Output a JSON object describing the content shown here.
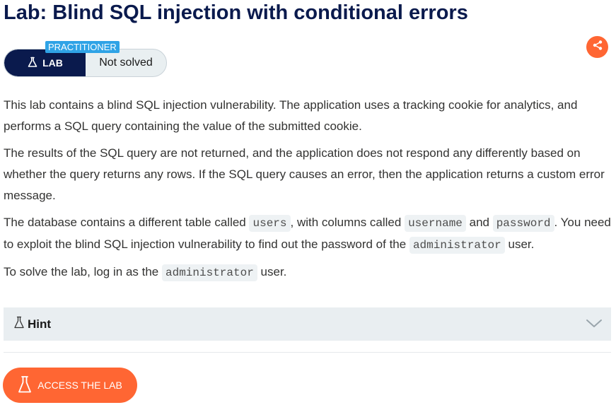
{
  "page": {
    "title": "Lab: Blind SQL injection with conditional errors"
  },
  "badge": {
    "level": "PRACTITIONER",
    "lab_label": "LAB",
    "status": "Not solved"
  },
  "description": {
    "p1": "This lab contains a blind SQL injection vulnerability. The application uses a tracking cookie for analytics, and performs a SQL query containing the value of the submitted cookie.",
    "p2": "The results of the SQL query are not returned, and the application does not respond any differently based on whether the query returns any rows. If the SQL query causes an error, then the application returns a custom error message.",
    "p3": {
      "t1": "The database contains a different table called ",
      "c1": "users",
      "t2": ", with columns called ",
      "c2": "username",
      "t3": " and ",
      "c3": "password",
      "t4": ". You need to exploit the blind SQL injection vulnerability to find out the password of the ",
      "c4": "administrator",
      "t5": " user."
    },
    "p4": {
      "t1": "To solve the lab, log in as the ",
      "c1": "administrator",
      "t2": " user."
    }
  },
  "hint": {
    "label": "Hint"
  },
  "access_button": {
    "label": "ACCESS THE LAB"
  },
  "colors": {
    "navy": "#0a1a4d",
    "orange": "#ff6633",
    "level_blue": "#2fa3e6",
    "hint_bg": "#e9eef1"
  },
  "icons": {
    "lab": "flask-icon",
    "share": "share-icon",
    "hint": "flask-icon",
    "expand": "chevron-down-icon"
  }
}
